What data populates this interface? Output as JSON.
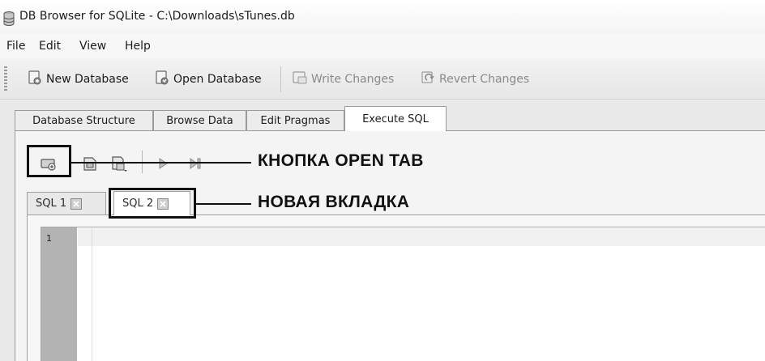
{
  "window": {
    "title": "DB Browser for SQLite - C:\\Downloads\\sTunes.db"
  },
  "menu": {
    "items": [
      "File",
      "Edit",
      "View",
      "Help"
    ]
  },
  "toolbar": {
    "new_database": "New Database",
    "open_database": "Open Database",
    "write_changes": "Write Changes",
    "revert_changes": "Revert Changes"
  },
  "main_tabs": {
    "items": [
      "Database Structure",
      "Browse Data",
      "Edit Pragmas",
      "Execute SQL"
    ],
    "active": "Execute SQL"
  },
  "sql_tabs": {
    "items": [
      "SQL 1",
      "SQL 2"
    ],
    "active": "SQL 2"
  },
  "editor": {
    "line_number": "1",
    "content": ""
  },
  "annotations": {
    "open_tab_label": "КНОПКА OPEN TAB",
    "new_tab_label": "НОВАЯ ВКЛАДКА"
  },
  "icons": {
    "app": "database-icon",
    "new_database": "new-database-icon",
    "open_database": "open-database-icon",
    "write_changes": "write-changes-icon",
    "revert_changes": "revert-changes-icon",
    "open_tab": "open-tab-icon",
    "open_sql_file": "open-sql-file-icon",
    "save_sql_file": "save-sql-file-icon",
    "execute_all": "play-icon",
    "execute_line": "step-icon",
    "close_tab": "close-icon"
  }
}
